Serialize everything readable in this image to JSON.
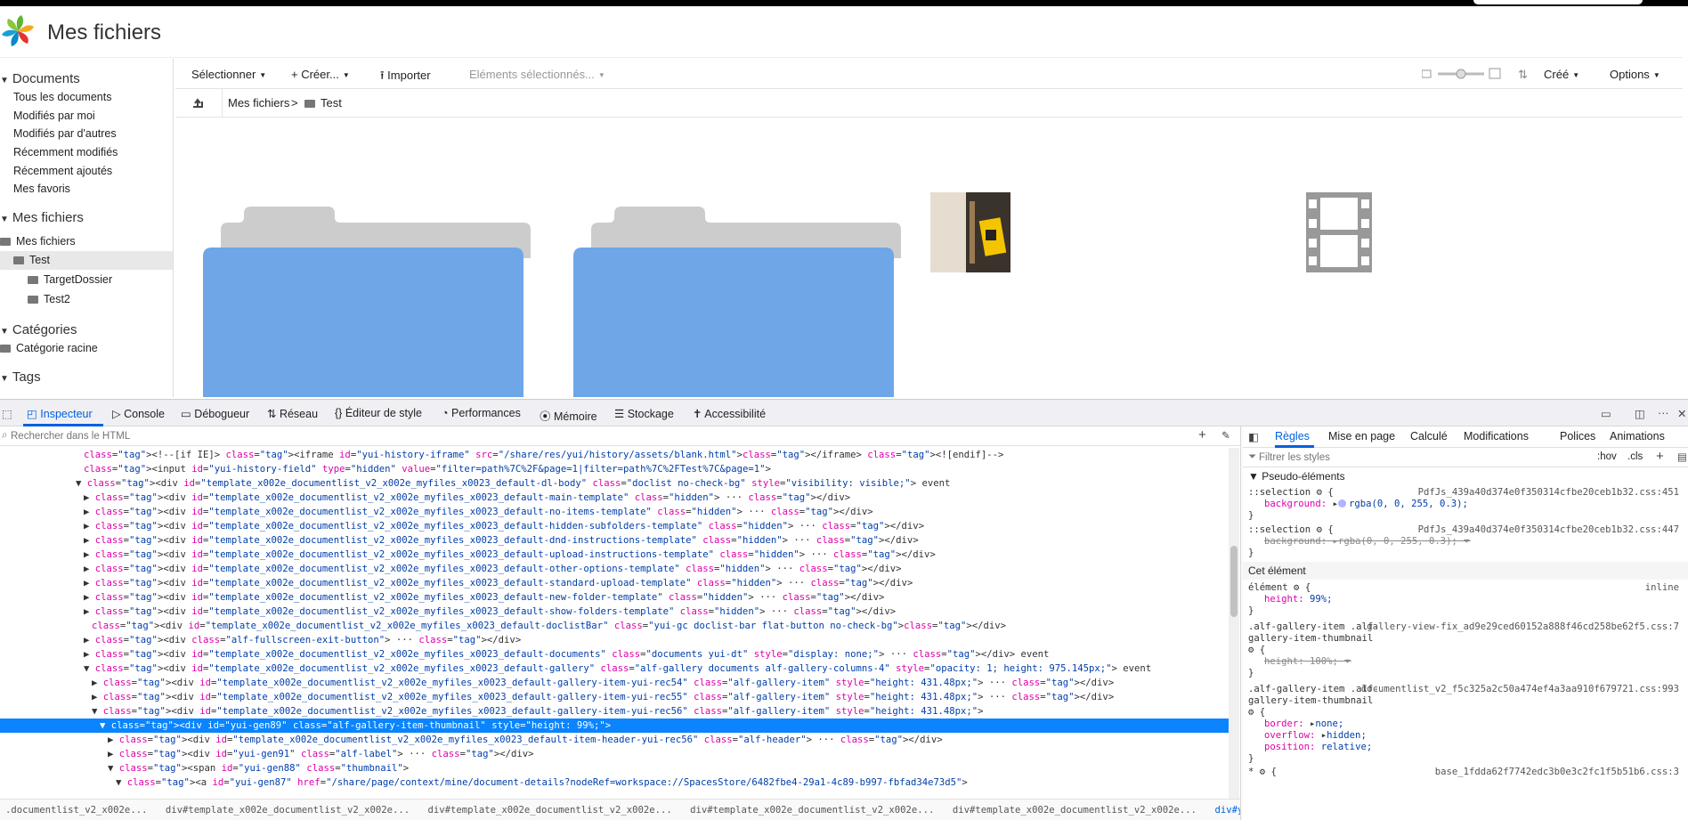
{
  "header": {
    "title": "Mes fichiers"
  },
  "sidebar": {
    "documents_head": "Documents",
    "documents_items": [
      "Tous les documents",
      "Modifiés par moi",
      "Modifiés par d'autres",
      "Récemment modifiés",
      "Récemment ajoutés",
      "Mes favoris"
    ],
    "myfiles_head": "Mes fichiers",
    "tree": [
      "Mes fichiers",
      "Test",
      "TargetDossier",
      "Test2"
    ],
    "categories_head": "Catégories",
    "categories_items": [
      "Catégorie racine"
    ],
    "tags_head": "Tags"
  },
  "toolbar": {
    "select": "Sélectionner",
    "create": "Créer...",
    "import": "Importer",
    "selected_items": "Eléments sélectionnés...",
    "sort": "Créé",
    "options": "Options"
  },
  "breadcrumb": {
    "root": "Mes fichiers",
    "sep": ">",
    "current": "Test"
  },
  "devtools": {
    "tabs": [
      "Inspecteur",
      "Console",
      "Débogueur",
      "Réseau",
      "Éditeur de style",
      "Performances",
      "Mémoire",
      "Stockage",
      "Accessibilité"
    ],
    "search_placeholder": "Rechercher dans le HTML",
    "html_lines": [
      {
        "i": 11,
        "t": "<!--[if IE]> <iframe id=\"yui-history-iframe\" src=\"/share/res/yui/history/assets/blank.html\"></iframe> <![endif]-->"
      },
      {
        "i": 11,
        "t": "<input id=\"yui-history-field\" type=\"hidden\" value=\"filter=path%7C%2F&page=1|filter=path%7C%2FTest%7C&page=1\">"
      },
      {
        "i": 10,
        "t": "▼ <div id=\"template_x002e_documentlist_v2_x002e_myfiles_x0023_default-dl-body\" class=\"doclist no-check-bg\" style=\"visibility: visible;\"> event"
      },
      {
        "i": 11,
        "t": "▶ <div id=\"template_x002e_documentlist_v2_x002e_myfiles_x0023_default-main-template\" class=\"hidden\"> ··· </div>"
      },
      {
        "i": 11,
        "t": "▶ <div id=\"template_x002e_documentlist_v2_x002e_myfiles_x0023_default-no-items-template\" class=\"hidden\"> ··· </div>"
      },
      {
        "i": 11,
        "t": "▶ <div id=\"template_x002e_documentlist_v2_x002e_myfiles_x0023_default-hidden-subfolders-template\" class=\"hidden\"> ··· </div>"
      },
      {
        "i": 11,
        "t": "▶ <div id=\"template_x002e_documentlist_v2_x002e_myfiles_x0023_default-dnd-instructions-template\" class=\"hidden\"> ··· </div>"
      },
      {
        "i": 11,
        "t": "▶ <div id=\"template_x002e_documentlist_v2_x002e_myfiles_x0023_default-upload-instructions-template\" class=\"hidden\"> ··· </div>"
      },
      {
        "i": 11,
        "t": "▶ <div id=\"template_x002e_documentlist_v2_x002e_myfiles_x0023_default-other-options-template\" class=\"hidden\"> ··· </div>"
      },
      {
        "i": 11,
        "t": "▶ <div id=\"template_x002e_documentlist_v2_x002e_myfiles_x0023_default-standard-upload-template\" class=\"hidden\"> ··· </div>"
      },
      {
        "i": 11,
        "t": "▶ <div id=\"template_x002e_documentlist_v2_x002e_myfiles_x0023_default-new-folder-template\" class=\"hidden\"> ··· </div>"
      },
      {
        "i": 11,
        "t": "▶ <div id=\"template_x002e_documentlist_v2_x002e_myfiles_x0023_default-show-folders-template\" class=\"hidden\"> ··· </div>"
      },
      {
        "i": 12,
        "t": "<div id=\"template_x002e_documentlist_v2_x002e_myfiles_x0023_default-doclistBar\" class=\"yui-gc doclist-bar flat-button no-check-bg\"></div>"
      },
      {
        "i": 11,
        "t": "▶ <div class=\"alf-fullscreen-exit-button\"> ··· </div>"
      },
      {
        "i": 11,
        "t": "▶ <div id=\"template_x002e_documentlist_v2_x002e_myfiles_x0023_default-documents\" class=\"documents yui-dt\" style=\"display: none;\"> ··· </div> event"
      },
      {
        "i": 11,
        "t": "▼ <div id=\"template_x002e_documentlist_v2_x002e_myfiles_x0023_default-gallery\" class=\"alf-gallery documents alf-gallery-columns-4\" style=\"opacity: 1; height: 975.145px;\"> event"
      },
      {
        "i": 12,
        "t": "▶ <div id=\"template_x002e_documentlist_v2_x002e_myfiles_x0023_default-gallery-item-yui-rec54\" class=\"alf-gallery-item\" style=\"height: 431.48px;\"> ··· </div>"
      },
      {
        "i": 12,
        "t": "▶ <div id=\"template_x002e_documentlist_v2_x002e_myfiles_x0023_default-gallery-item-yui-rec55\" class=\"alf-gallery-item\" style=\"height: 431.48px;\"> ··· </div>"
      },
      {
        "i": 12,
        "t": "▼ <div id=\"template_x002e_documentlist_v2_x002e_myfiles_x0023_default-gallery-item-yui-rec56\" class=\"alf-gallery-item\" style=\"height: 431.48px;\">"
      },
      {
        "i": 13,
        "t": "▼ <div id=\"yui-gen89\" class=\"alf-gallery-item-thumbnail\" style=\"height: 99%;\">",
        "sel": true
      },
      {
        "i": 14,
        "t": "▶ <div id=\"template_x002e_documentlist_v2_x002e_myfiles_x0023_default-item-header-yui-rec56\" class=\"alf-header\"> ··· </div>"
      },
      {
        "i": 14,
        "t": "▶ <div id=\"yui-gen91\" class=\"alf-label\"> ··· </div>"
      },
      {
        "i": 14,
        "t": "▼ <span id=\"yui-gen88\" class=\"thumbnail\">"
      },
      {
        "i": 15,
        "t": "▼ <a id=\"yui-gen87\" href=\"/share/page/context/mine/document-details?nodeRef=workspace://SpacesStore/6482fbe4-29a1-4c89-b997-fbfad34e73d5\">"
      }
    ],
    "breadcrumb_path": [
      ".documentlist_v2_x002e...",
      "div#template_x002e_documentlist_v2_x002e...",
      "div#template_x002e_documentlist_v2_x002e...",
      "div#template_x002e_documentlist_v2_x002e...",
      "div#template_x002e_documentlist_v2_x002e...",
      "div#yui-gen89.alf-gallery-item-thumbnail"
    ],
    "rules_tabs": [
      "Règles",
      "Mise en page",
      "Calculé",
      "Modifications",
      "Polices",
      "Animations"
    ],
    "filter_placeholder": "Filtrer les styles",
    "hov": ":hov",
    "cls": ".cls",
    "pseudo_head": "Pseudo-éléments",
    "this_element_head": "Cet élément",
    "rules": {
      "sel1": "::selection",
      "src1": "PdfJs_439a40d374e0f350314cfbe20ceb1b32.css:451",
      "prop1": "background:",
      "val1": "rgba(0, 0, 255, 0.3);",
      "sel2": "::selection",
      "src2": "PdfJs_439a40d374e0f350314cfbe20ceb1b32.css:447",
      "prop2": "background:",
      "val2": "rgba(0, 0, 255, 0.3);",
      "el_sel": "élément",
      "el_src": "inline",
      "el_prop": "height:",
      "el_val": "99%;",
      "g1_sel_a": ".alf-gallery-item .alf-",
      "g1_sel_b": "gallery-item-thumbnail",
      "g1_src": "gallery-view-fix_ad9e29ced60152a888f46cd258be62f5.css:7",
      "g1_prop": "height:",
      "g1_val": "100%;",
      "g2_sel_a": ".alf-gallery-item .alf-",
      "g2_sel_b": "gallery-item-thumbnail",
      "g2_src": "documentlist_v2_f5c325a2c50a474ef4a3aa910f679721.css:993",
      "g2_props": [
        [
          "border:",
          "none;"
        ],
        [
          "overflow:",
          "hidden;"
        ],
        [
          "position:",
          "relative;"
        ]
      ],
      "last_sel": "*",
      "last_src": "base_1fdda62f7742edc3b0e3c2fc1f5b51b6.css:3"
    }
  },
  "colors": {
    "folder_front": "#6ea6e8",
    "folder_back": "#cccccc",
    "video_icon": "#999999",
    "accent": "#0a84ff"
  }
}
